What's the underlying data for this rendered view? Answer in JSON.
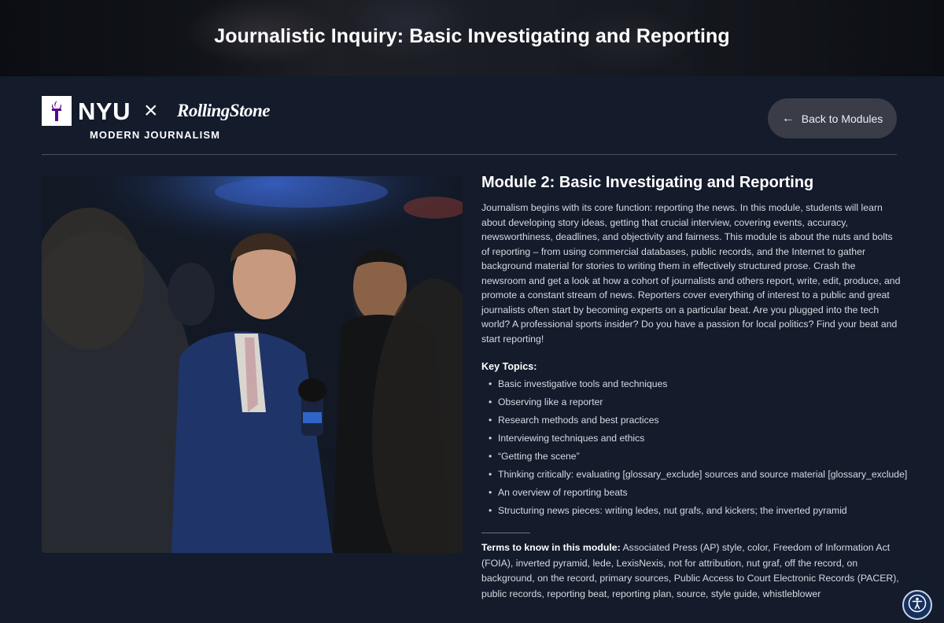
{
  "banner": {
    "title": "Journalistic Inquiry: Basic Investigating and Reporting"
  },
  "logo": {
    "nyu": "NYU",
    "times": "×",
    "partner": "RollingStone",
    "program": "MODERN JOURNALISM"
  },
  "nav": {
    "back_label": "Back to Modules",
    "back_icon": "arrow-left-icon"
  },
  "photo": {
    "alt": "Reporter holding a microphone interviewing a man in a crowd"
  },
  "module": {
    "title": "Module 2: Basic Investigating and Reporting",
    "description": "Journalism begins with its core function: reporting the news. In this module, students will learn about developing story ideas, getting that crucial interview, covering events, accuracy, newsworthiness, deadlines, and objectivity and fairness. This module is about the nuts and bolts of reporting – from using commercial databases, public records, and the Internet to gather background material for stories to writing them in effectively structured prose. Crash the newsroom and get a look at how a cohort of journalists and others report, write, edit, produce, and promote a constant stream of news. Reporters cover everything of interest to a public and great journalists often start by becoming experts on a particular beat. Are you plugged into the tech world? A professional sports insider? Do you have a passion for local politics? Find your beat and start reporting!",
    "topics_heading": "Key Topics:",
    "topics": [
      "Basic investigative tools and techniques",
      "Observing like a reporter",
      "Research methods and best practices",
      "Interviewing techniques and ethics",
      "“Getting the scene”",
      "Thinking critically: evaluating [glossary_exclude] sources and source material [glossary_exclude]",
      "An overview of reporting beats",
      "Structuring news pieces: writing ledes, nut grafs, and kickers; the inverted pyramid"
    ],
    "terms_label": "Terms to know in this module:",
    "terms": "Associated Press (AP) style, color, Freedom of Information Act (FOIA), inverted pyramid, lede, LexisNexis, not for attribution, nut graf, off the record, on background, on the record, primary sources, Public Access to Court Electronic Records (PACER), public records, reporting beat, reporting plan, source, style guide, whistleblower"
  },
  "accessibility": {
    "icon": "accessibility-icon"
  },
  "colors": {
    "background": "#141b2b",
    "button_bg": "#3a3d48",
    "accessibility_bg": "#17315d"
  }
}
